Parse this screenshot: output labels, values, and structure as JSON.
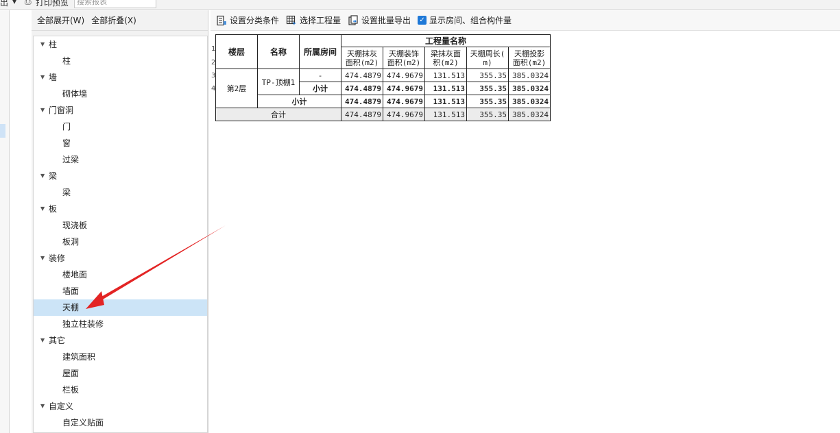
{
  "topbar": {
    "left_label": "出",
    "print_preview": "打印预览",
    "search_placeholder": "搜索报表"
  },
  "tree_tools": {
    "expand_all": "全部展开(W)",
    "collapse_all": "全部折叠(X)"
  },
  "tree": [
    {
      "type": "group",
      "label": "柱"
    },
    {
      "type": "leaf",
      "label": "柱"
    },
    {
      "type": "group",
      "label": "墙"
    },
    {
      "type": "leaf",
      "label": "砌体墙"
    },
    {
      "type": "group",
      "label": "门窗洞"
    },
    {
      "type": "leaf",
      "label": "门"
    },
    {
      "type": "leaf",
      "label": "窗"
    },
    {
      "type": "leaf",
      "label": "过梁"
    },
    {
      "type": "group",
      "label": "梁"
    },
    {
      "type": "leaf",
      "label": "梁"
    },
    {
      "type": "group",
      "label": "板"
    },
    {
      "type": "leaf",
      "label": "现浇板"
    },
    {
      "type": "leaf",
      "label": "板洞"
    },
    {
      "type": "group",
      "label": "装修"
    },
    {
      "type": "leaf",
      "label": "楼地面"
    },
    {
      "type": "leaf",
      "label": "墙面"
    },
    {
      "type": "leaf",
      "label": "天棚",
      "selected": true
    },
    {
      "type": "leaf",
      "label": "独立柱装修"
    },
    {
      "type": "group",
      "label": "其它"
    },
    {
      "type": "leaf",
      "label": "建筑面积"
    },
    {
      "type": "leaf",
      "label": "屋面"
    },
    {
      "type": "leaf",
      "label": "栏板"
    },
    {
      "type": "group",
      "label": "自定义"
    },
    {
      "type": "leaf",
      "label": "自定义贴面"
    }
  ],
  "report_tools": {
    "set_classify": "设置分类条件",
    "select_quantity": "选择工程量",
    "batch_export": "设置批量导出",
    "show_room": "显示房间、组合构件量"
  },
  "table": {
    "h_floor": "楼层",
    "h_name": "名称",
    "h_room": "所属房间",
    "h_group": "工程量名称",
    "sub_headers": [
      "天棚抹灰\n面积(m2)",
      "天棚装饰\n面积(m2)",
      "梁抹灰面\n积(m2)",
      "天棚周长(\nm)",
      "天棚投影\n面积(m2)"
    ],
    "floor": "第2层",
    "name": "TP-顶棚1",
    "room_dash": "-",
    "subtotal": "小计",
    "total": "合计",
    "row_dash": [
      "474.4879",
      "474.9679",
      "131.513",
      "355.35",
      "385.0324"
    ],
    "row_sub_name": [
      "474.4879",
      "474.9679",
      "131.513",
      "355.35",
      "385.0324"
    ],
    "row_sub_floor": [
      "474.4879",
      "474.9679",
      "131.513",
      "355.35",
      "385.0324"
    ],
    "row_total": [
      "474.4879",
      "474.9679",
      "131.513",
      "355.35",
      "385.0324"
    ],
    "row_numbers": [
      "1",
      "2",
      "3",
      "4"
    ]
  }
}
